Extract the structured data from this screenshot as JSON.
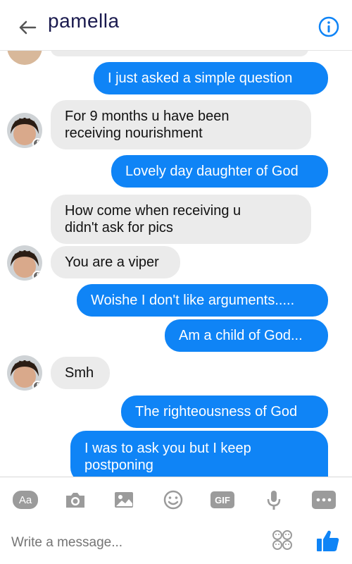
{
  "header": {
    "title": "pamella",
    "back_icon": "back-arrow-icon",
    "info_icon": "info-icon"
  },
  "colors": {
    "outgoing_bubble": "#0f84f6",
    "incoming_bubble": "#ebebeb",
    "accent": "#0f84f6",
    "toolbar_icon": "#9b9b9b"
  },
  "messages": [
    {
      "direction": "out",
      "lines": [
        "I just asked a simple question"
      ]
    },
    {
      "direction": "in",
      "lines": [
        "For 9 months u have been",
        "receiving nourishment"
      ]
    },
    {
      "direction": "out",
      "lines": [
        "Lovely day daughter of God"
      ]
    },
    {
      "direction": "in",
      "lines": [
        "How come when receiving u",
        "didn't ask for pics"
      ]
    },
    {
      "direction": "in",
      "lines": [
        "You are a viper"
      ]
    },
    {
      "direction": "out",
      "lines": [
        "Woishe I don't like arguments....."
      ]
    },
    {
      "direction": "out",
      "lines": [
        "Am a child of God..."
      ]
    },
    {
      "direction": "in",
      "lines": [
        "Smh"
      ]
    },
    {
      "direction": "out",
      "lines": [
        "The righteousness of God"
      ]
    },
    {
      "direction": "out",
      "lines": [
        "I was to ask you but I keep",
        "postponing"
      ]
    }
  ],
  "toolbar": {
    "aa_label": "Aa",
    "gif_label": "GIF",
    "icons": [
      "text-format-icon",
      "camera-icon",
      "gallery-icon",
      "emoji-icon",
      "gif-icon",
      "microphone-icon",
      "more-icon"
    ]
  },
  "composer": {
    "placeholder": "Write a message...",
    "stickers_icon": "stickers-icon",
    "like_icon": "thumbs-up-icon"
  }
}
